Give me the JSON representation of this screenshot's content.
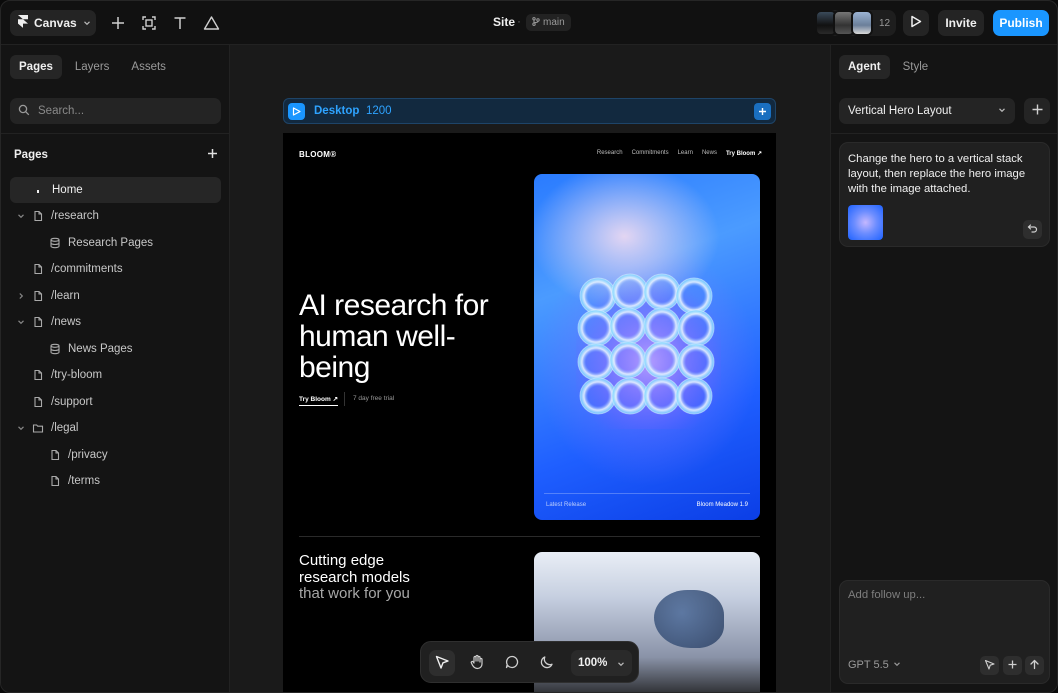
{
  "topbar": {
    "menu_label": "Canvas",
    "site_title": "Site",
    "branch": "main",
    "collaborator_count": "12",
    "invite_label": "Invite",
    "publish_label": "Publish",
    "publish_color": "#1a96ff"
  },
  "left": {
    "tabs": [
      "Pages",
      "Layers",
      "Assets"
    ],
    "active_tab": "Pages",
    "search_placeholder": "Search...",
    "section_title": "Pages",
    "tree": [
      {
        "label": "Home",
        "icon": "home-dot-icon",
        "selected": true
      },
      {
        "label": "/research",
        "icon": "page-icon",
        "expanded": true
      },
      {
        "label": "Research Pages",
        "icon": "database-icon"
      },
      {
        "label": "/commitments",
        "icon": "page-icon"
      },
      {
        "label": "/learn",
        "icon": "page-icon",
        "expanded": false
      },
      {
        "label": "/news",
        "icon": "page-icon",
        "expanded": true
      },
      {
        "label": "News Pages",
        "icon": "database-icon"
      },
      {
        "label": "/try-bloom",
        "icon": "page-icon"
      },
      {
        "label": "/support",
        "icon": "page-icon"
      },
      {
        "label": "/legal",
        "icon": "folder-icon",
        "expanded": true
      },
      {
        "label": "/privacy",
        "icon": "page-icon"
      },
      {
        "label": "/terms",
        "icon": "page-icon"
      }
    ]
  },
  "canvas": {
    "frame_name": "Desktop",
    "frame_width": "1200",
    "zoom": "100%",
    "site": {
      "logo": "BLOOM®",
      "nav": [
        "Research",
        "Commitments",
        "Learn",
        "News",
        "Try Bloom ↗"
      ],
      "hero_title": "AI research for human well-being",
      "hero_link": "Try Bloom ↗",
      "hero_trial": "7 day free trial",
      "card_left": "Latest Release",
      "card_right": "Bloom Meadow 1.9",
      "section2_line1": "Cutting edge",
      "section2_line2": "research models",
      "section2_line3": "that work for you"
    }
  },
  "right": {
    "tabs": [
      "Agent",
      "Style"
    ],
    "active_tab": "Agent",
    "layout_select": "Vertical Hero Layout",
    "message": "Change the hero to a vertical stack layout, then replace the hero image with the image attached.",
    "composer_placeholder": "Add follow up...",
    "model": "GPT 5.5"
  }
}
